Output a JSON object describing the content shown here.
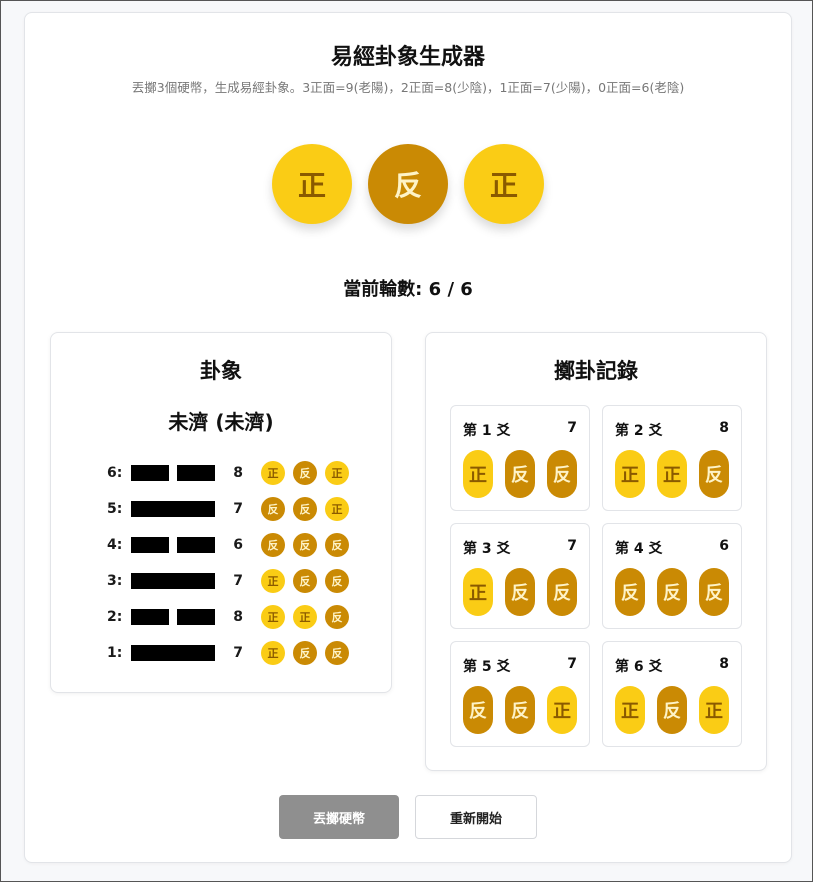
{
  "title": "易經卦象生成器",
  "subtitle": "丟擲3個硬幣，生成易經卦象。3正面=9(老陽)，2正面=8(少陰)，1正面=7(少陽)，0正面=6(老陰)",
  "current_coins": [
    {
      "label": "正",
      "face": "heads"
    },
    {
      "label": "反",
      "face": "tails"
    },
    {
      "label": "正",
      "face": "heads"
    }
  ],
  "round_text": "當前輪數: 6 / 6",
  "hexagram": {
    "title": "卦象",
    "name": "未濟 (未濟)",
    "lines": [
      {
        "label": "6:",
        "type": "yin",
        "value": "8",
        "coins": [
          {
            "label": "正",
            "face": "heads"
          },
          {
            "label": "反",
            "face": "tails"
          },
          {
            "label": "正",
            "face": "heads"
          }
        ]
      },
      {
        "label": "5:",
        "type": "yang",
        "value": "7",
        "coins": [
          {
            "label": "反",
            "face": "tails"
          },
          {
            "label": "反",
            "face": "tails"
          },
          {
            "label": "正",
            "face": "heads"
          }
        ]
      },
      {
        "label": "4:",
        "type": "yin",
        "value": "6",
        "coins": [
          {
            "label": "反",
            "face": "tails"
          },
          {
            "label": "反",
            "face": "tails"
          },
          {
            "label": "反",
            "face": "tails"
          }
        ]
      },
      {
        "label": "3:",
        "type": "yang",
        "value": "7",
        "coins": [
          {
            "label": "正",
            "face": "heads"
          },
          {
            "label": "反",
            "face": "tails"
          },
          {
            "label": "反",
            "face": "tails"
          }
        ]
      },
      {
        "label": "2:",
        "type": "yin",
        "value": "8",
        "coins": [
          {
            "label": "正",
            "face": "heads"
          },
          {
            "label": "正",
            "face": "heads"
          },
          {
            "label": "反",
            "face": "tails"
          }
        ]
      },
      {
        "label": "1:",
        "type": "yang",
        "value": "7",
        "coins": [
          {
            "label": "正",
            "face": "heads"
          },
          {
            "label": "反",
            "face": "tails"
          },
          {
            "label": "反",
            "face": "tails"
          }
        ]
      }
    ]
  },
  "records": {
    "title": "擲卦記錄",
    "items": [
      {
        "label": "第 1 爻",
        "value": "7",
        "coins": [
          {
            "label": "正",
            "face": "heads"
          },
          {
            "label": "反",
            "face": "tails"
          },
          {
            "label": "反",
            "face": "tails"
          }
        ]
      },
      {
        "label": "第 2 爻",
        "value": "8",
        "coins": [
          {
            "label": "正",
            "face": "heads"
          },
          {
            "label": "正",
            "face": "heads"
          },
          {
            "label": "反",
            "face": "tails"
          }
        ]
      },
      {
        "label": "第 3 爻",
        "value": "7",
        "coins": [
          {
            "label": "正",
            "face": "heads"
          },
          {
            "label": "反",
            "face": "tails"
          },
          {
            "label": "反",
            "face": "tails"
          }
        ]
      },
      {
        "label": "第 4 爻",
        "value": "6",
        "coins": [
          {
            "label": "反",
            "face": "tails"
          },
          {
            "label": "反",
            "face": "tails"
          },
          {
            "label": "反",
            "face": "tails"
          }
        ]
      },
      {
        "label": "第 5 爻",
        "value": "7",
        "coins": [
          {
            "label": "反",
            "face": "tails"
          },
          {
            "label": "反",
            "face": "tails"
          },
          {
            "label": "正",
            "face": "heads"
          }
        ]
      },
      {
        "label": "第 6 爻",
        "value": "8",
        "coins": [
          {
            "label": "正",
            "face": "heads"
          },
          {
            "label": "反",
            "face": "tails"
          },
          {
            "label": "正",
            "face": "heads"
          }
        ]
      }
    ]
  },
  "buttons": {
    "toss": "丟擲硬幣",
    "reset": "重新開始"
  },
  "colors": {
    "heads_bg": "#facc15",
    "heads_text": "#8a5a00",
    "tails_bg": "#ca8a04",
    "tails_text": "#fef3c7",
    "disabled_button": "#8f8f8f"
  }
}
